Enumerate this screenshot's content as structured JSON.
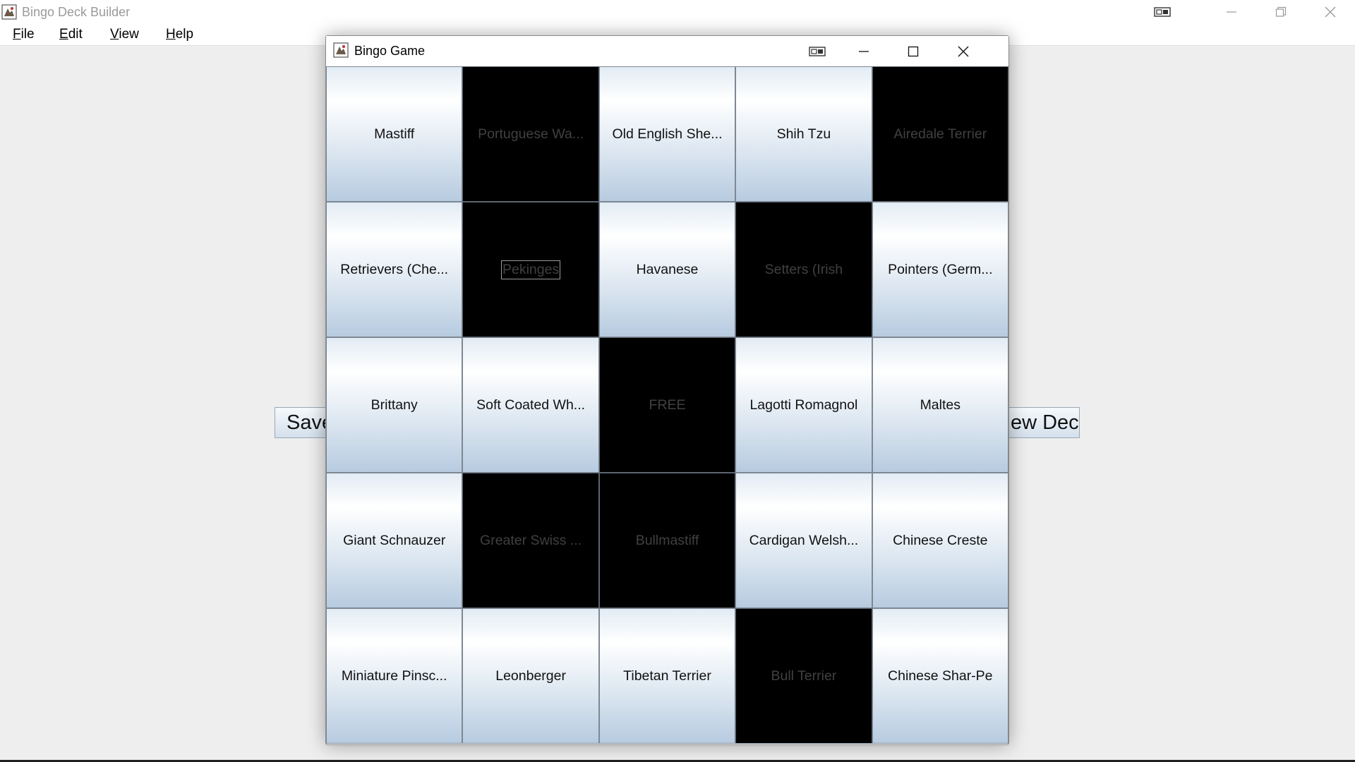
{
  "main_window": {
    "title": "Bingo Deck Builder",
    "app_icon": "java-app-icon",
    "controls": [
      "snap-icon",
      "minimize-icon",
      "restore-icon",
      "close-icon"
    ]
  },
  "menu": [
    {
      "mnemonic": "F",
      "rest": "ile"
    },
    {
      "mnemonic": "E",
      "rest": "dit"
    },
    {
      "mnemonic": "V",
      "rest": "iew"
    },
    {
      "mnemonic": "H",
      "rest": "elp"
    }
  ],
  "background_buttons": {
    "save_label": "Save",
    "new_deck_label": "New Deck"
  },
  "bingo_window": {
    "title": "Bingo Game",
    "app_icon": "java-app-icon",
    "controls": [
      "snap-icon",
      "minimize-icon",
      "maximize-icon",
      "close-icon"
    ],
    "cells": [
      {
        "label": "Mastiff",
        "marked": false
      },
      {
        "label": "Portuguese Wa...",
        "marked": true
      },
      {
        "label": "Old English She...",
        "marked": false
      },
      {
        "label": "Shih Tzu",
        "marked": false
      },
      {
        "label": "Airedale Terrier",
        "marked": true
      },
      {
        "label": "Retrievers (Che...",
        "marked": false
      },
      {
        "label": "Pekinges",
        "marked": true,
        "focused": true
      },
      {
        "label": "Havanese",
        "marked": false
      },
      {
        "label": "Setters (Irish",
        "marked": true
      },
      {
        "label": "Pointers (Germ...",
        "marked": false
      },
      {
        "label": "Brittany",
        "marked": false
      },
      {
        "label": "Soft Coated Wh...",
        "marked": false
      },
      {
        "label": "FREE",
        "marked": true
      },
      {
        "label": "Lagotti Romagnol",
        "marked": false
      },
      {
        "label": "Maltes",
        "marked": false
      },
      {
        "label": "Giant Schnauzer",
        "marked": false
      },
      {
        "label": "Greater Swiss ...",
        "marked": true
      },
      {
        "label": "Bullmastiff",
        "marked": true
      },
      {
        "label": "Cardigan Welsh...",
        "marked": false
      },
      {
        "label": "Chinese Creste",
        "marked": false
      },
      {
        "label": "Miniature Pinsc...",
        "marked": false
      },
      {
        "label": "Leonberger",
        "marked": false
      },
      {
        "label": "Tibetan Terrier",
        "marked": false
      },
      {
        "label": "Bull Terrier",
        "marked": true
      },
      {
        "label": "Chinese Shar-Pe",
        "marked": false
      }
    ]
  }
}
